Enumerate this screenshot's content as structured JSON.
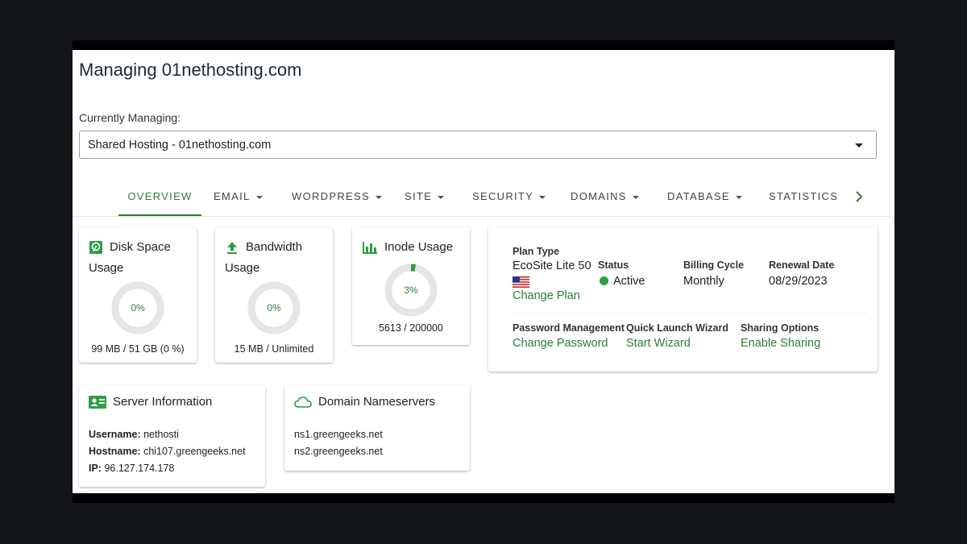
{
  "page": {
    "title": "Managing 01nethosting.com",
    "currently_managing_label": "Currently Managing:",
    "selected_account": "Shared Hosting - 01nethosting.com"
  },
  "tabs": [
    {
      "label": "OVERVIEW",
      "active": true,
      "dropdown": false
    },
    {
      "label": "EMAIL",
      "active": false,
      "dropdown": true
    },
    {
      "label": "WORDPRESS",
      "active": false,
      "dropdown": true
    },
    {
      "label": "SITE",
      "active": false,
      "dropdown": true
    },
    {
      "label": "SECURITY",
      "active": false,
      "dropdown": true
    },
    {
      "label": "DOMAINS",
      "active": false,
      "dropdown": true
    },
    {
      "label": "DATABASE",
      "active": false,
      "dropdown": true
    },
    {
      "label": "STATISTICS",
      "active": false,
      "dropdown": false
    }
  ],
  "usage": {
    "disk": {
      "title_line1": "Disk Space",
      "title_line2": "Usage",
      "percent_label": "0%",
      "percent": 0,
      "detail": "99 MB / 51 GB (0 %)",
      "icon": "hard-drive-icon"
    },
    "bandwidth": {
      "title_line1": "Bandwidth",
      "title_line2": "Usage",
      "percent_label": "0%",
      "percent": 0,
      "detail": "15 MB / Unlimited",
      "icon": "upload-icon"
    },
    "inode": {
      "title": "Inode Usage",
      "percent_label": "3%",
      "percent": 3,
      "detail": "5613 / 200000",
      "icon": "bar-chart-icon"
    }
  },
  "plan": {
    "plan_type_label": "Plan Type",
    "plan_type_value": "EcoSite Lite 50",
    "change_plan": "Change Plan",
    "status_label": "Status",
    "status_value": "Active",
    "billing_cycle_label": "Billing Cycle",
    "billing_cycle_value": "Monthly",
    "renewal_date_label": "Renewal Date",
    "renewal_date_value": "08/29/2023",
    "password_label": "Password Management",
    "password_link": "Change Password",
    "wizard_label": "Quick Launch Wizard",
    "wizard_link": "Start Wizard",
    "sharing_label": "Sharing Options",
    "sharing_link": "Enable Sharing"
  },
  "server": {
    "title": "Server Information",
    "username_label": "Username:",
    "username": "nethosti",
    "hostname_label": "Hostname:",
    "hostname": "chi107.greengeeks.net",
    "ip_label": "IP:",
    "ip": "96.127.174.178"
  },
  "nameservers": {
    "title": "Domain Nameservers",
    "ns1": "ns1.greengeeks.net",
    "ns2": "ns2.greengeeks.net"
  },
  "colors": {
    "accent": "#2e7d3a",
    "status_active": "#2e9e44",
    "ring_track": "#e6e6e6"
  }
}
